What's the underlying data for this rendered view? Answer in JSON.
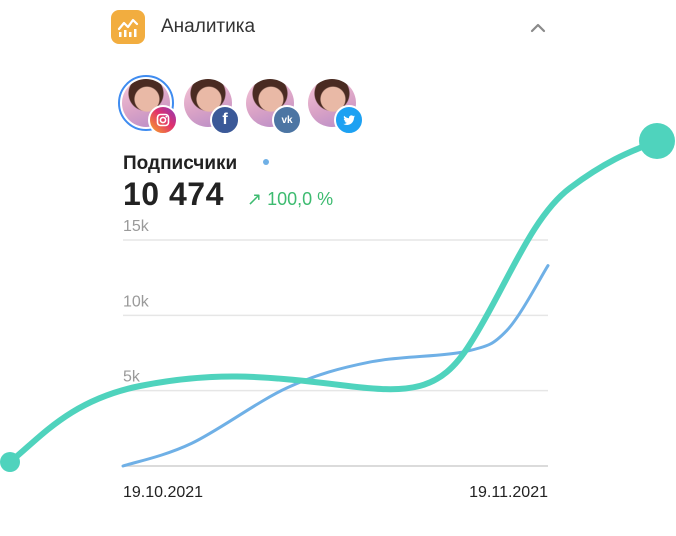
{
  "header": {
    "title": "Аналитика",
    "icon": "analytics-chart-icon",
    "collapse_icon": "chevron-up-icon",
    "accent": "#f2ad3f"
  },
  "accounts": [
    {
      "network": "instagram",
      "icon": "instagram-icon",
      "selected": true
    },
    {
      "network": "facebook",
      "icon": "facebook-icon",
      "selected": false
    },
    {
      "network": "vk",
      "icon": "vk-icon",
      "selected": false
    },
    {
      "network": "twitter",
      "icon": "twitter-icon",
      "selected": false
    }
  ],
  "metric": {
    "title": "Подписчики",
    "value": "10 474",
    "change": "100,0 %",
    "change_icon": "arrow-up-right-icon",
    "change_color": "#3dbb70"
  },
  "chart_data": {
    "type": "line",
    "y_ticks": [
      "5k",
      "10k",
      "15k"
    ],
    "ylim": [
      0,
      15000
    ],
    "x_labels": [
      "19.10.2021",
      "19.11.2021"
    ],
    "grid": true,
    "series": [
      {
        "color": "#6fb0e6",
        "points": [
          [
            "19.10.2021",
            0
          ],
          [
            "24.10.2021",
            1500
          ],
          [
            "31.10.2021",
            5200
          ],
          [
            "06.11.2021",
            6900
          ],
          [
            "13.11.2021",
            7600
          ],
          [
            "16.11.2021",
            9000
          ],
          [
            "19.11.2021",
            13300
          ]
        ]
      }
    ]
  }
}
